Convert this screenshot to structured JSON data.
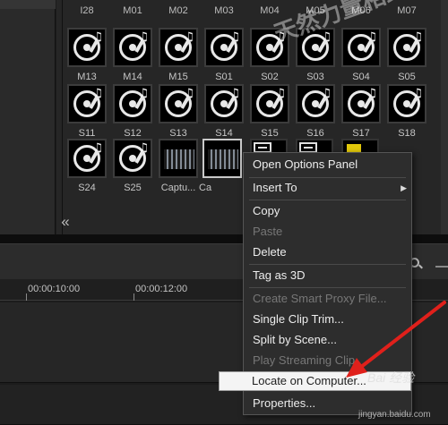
{
  "library": {
    "top_row_labels": [
      "I28",
      "M01",
      "M02",
      "M03",
      "M04",
      "M05",
      "M06",
      "M07"
    ],
    "row1": [
      "M13",
      "M14",
      "M15",
      "S01",
      "S02",
      "S03",
      "S04",
      "S05"
    ],
    "row2": [
      "S11",
      "S12",
      "S13",
      "S14",
      "S15",
      "S16",
      "S17",
      "S18"
    ],
    "row3": [
      "S24",
      "S25",
      "Captu...",
      "Ca"
    ],
    "collapse_glyph": "«"
  },
  "timeline": {
    "timecodes": [
      "00:00:10:00",
      "00:00:12:00"
    ]
  },
  "context_menu": {
    "items": [
      {
        "label": "Open Options Panel",
        "enabled": true
      },
      {
        "label": "Insert To",
        "enabled": true,
        "submenu": true
      },
      {
        "label": "Copy",
        "enabled": true
      },
      {
        "label": "Paste",
        "enabled": false
      },
      {
        "label": "Delete",
        "enabled": true
      },
      {
        "label": "Tag as 3D",
        "enabled": true
      },
      {
        "label": "Create Smart Proxy File...",
        "enabled": false
      },
      {
        "label": "Single Clip Trim...",
        "enabled": true
      },
      {
        "label": "Split by Scene...",
        "enabled": true
      },
      {
        "label": "Play Streaming Clip",
        "enabled": false
      },
      {
        "label": "Locate on Computer...",
        "enabled": true,
        "highlighted": true
      },
      {
        "label": "Properties...",
        "enabled": true
      }
    ],
    "submenu_arrow": "▶"
  },
  "watermark": {
    "top_text": "天然力量相约",
    "logo_text": "Bai 经验",
    "url": "jingyan.baidu.com"
  },
  "colors": {
    "annotation_arrow": "#e0201b",
    "selected_clip_border": "#c9c9c9"
  }
}
